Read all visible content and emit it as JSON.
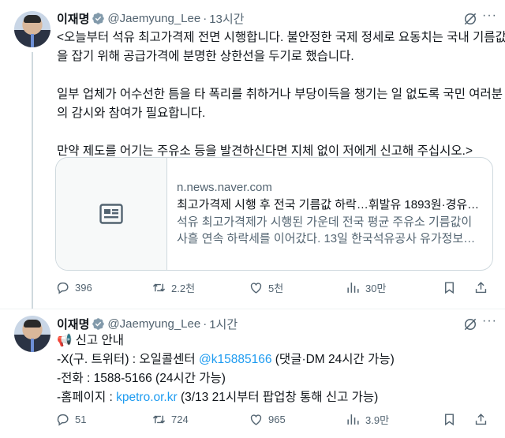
{
  "tweets": [
    {
      "name": "이재명",
      "handle": "@Jaemyung_Lee",
      "separator": "·",
      "time": "13시간",
      "paragraphs": [
        [
          "<오늘부터 석유 최고가격제 전면 시행합니다. 불안정한 국제 정세로 요동치는 국내 기름값",
          "을 잡기 위해 공급가격에 분명한 상한선을 두기로 했습니다."
        ],
        [
          "일부 업체가 어수선한 틈을 타 폭리를 취하거나 부당이득을 챙기는 일 없도록 국민 여러분",
          "의 감시와 참여가 필요합니다."
        ],
        [
          "만약 제도를 어기는 주유소 등을 발견하신다면 지체 없이 저에게 신고해 주십시오.>"
        ]
      ],
      "card": {
        "domain": "n.news.naver.com",
        "title": "최고가격제 시행 후 전국 기름값 하락…휘발유 1893원·경유 …",
        "desc_line1": "석유 최고가격제가 시행된 가운데 전국 평균 주유소 기름값이",
        "desc_line2": "사흘 연속 하락세를 이어갔다. 13일 한국석유공사 유가정보…"
      },
      "stats": {
        "replies": "396",
        "reposts": "2.2천",
        "likes": "5천",
        "views": "30만"
      }
    },
    {
      "name": "이재명",
      "handle": "@Jaemyung_Lee",
      "separator": "·",
      "time": "1시간",
      "emoji": "📢",
      "lines": {
        "title": "신고 안내",
        "x_prefix": "-X(구. 트위터) : 오일콜센터 ",
        "x_link": "@k15885166",
        "x_suffix": " (댓글·DM 24시간 가능)",
        "phone": "-전화 : 1588-5166 (24시간 가능)",
        "web_prefix": "-홈페이지 : ",
        "web_link": "kpetro.or.kr",
        "web_suffix": " (3/13 21시부터 팝업창 통해 신고 가능)"
      },
      "stats": {
        "replies": "51",
        "reposts": "724",
        "likes": "965",
        "views": "3.9만"
      }
    }
  ],
  "icons": {
    "verified": "verified-badge-icon",
    "grok": "grok-icon",
    "more": "more-options-icon",
    "reply": "reply-icon",
    "repost": "repost-icon",
    "like": "heart-icon",
    "views": "views-icon",
    "bookmark": "bookmark-icon",
    "share": "share-icon",
    "article": "article-icon"
  },
  "colors": {
    "accent": "#1d9bf0",
    "text": "#0f1419",
    "muted": "#536471",
    "border": "#cfd9de"
  }
}
